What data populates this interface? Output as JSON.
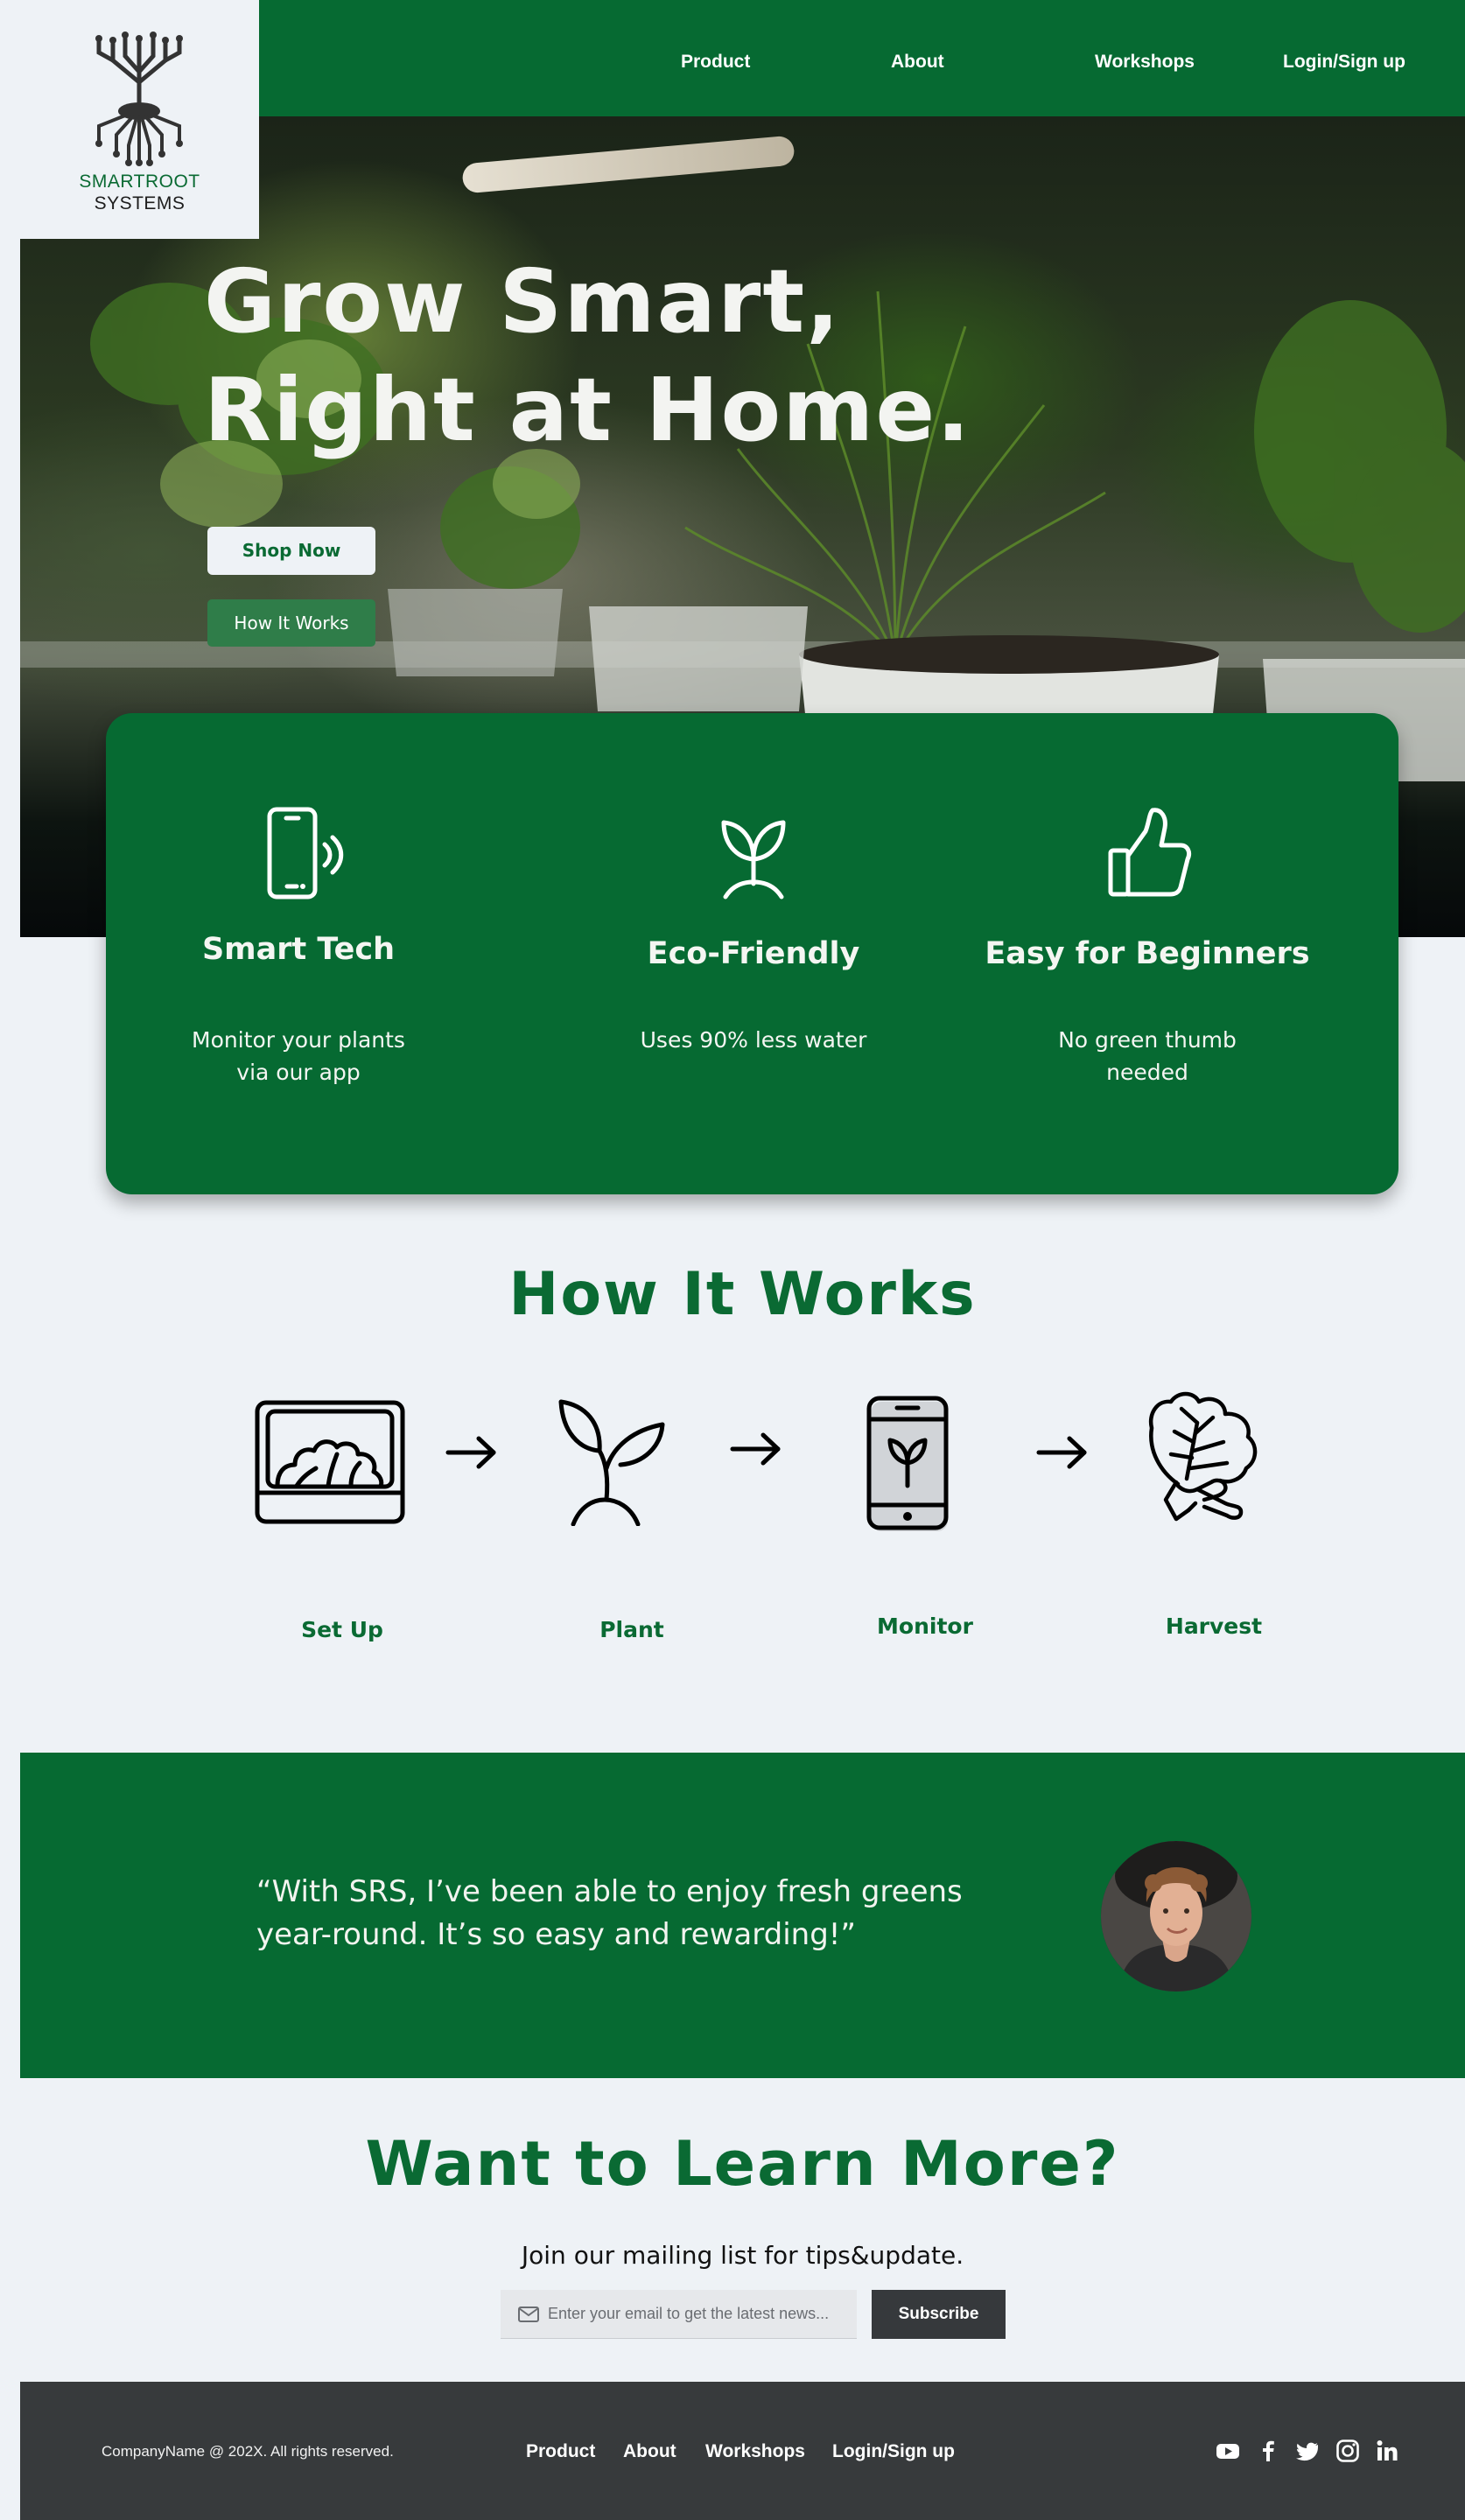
{
  "brand": {
    "line1": "SMARTROOT",
    "line2": "SYSTEMS",
    "logo_icon": "tree-roots-icon"
  },
  "nav": [
    "Product",
    "About",
    "Workshops",
    "Login/Sign up"
  ],
  "hero": {
    "title_line1": "Grow Smart,",
    "title_line2": "Right at Home.",
    "primary_button": "Shop Now",
    "secondary_button": "How It Works"
  },
  "features": [
    {
      "icon": "smartphone-wireless-icon",
      "title": "Smart Tech",
      "desc_line1": "Monitor your plants",
      "desc_line2": "via our app"
    },
    {
      "icon": "sprout-icon",
      "title": "Eco-Friendly",
      "desc_line1": "Uses 90% less water",
      "desc_line2": ""
    },
    {
      "icon": "thumbs-up-icon",
      "title": "Easy for Beginners",
      "desc_line1": "No green thumb needed",
      "desc_line2": ""
    }
  ],
  "how_it_works": {
    "title": "How It Works",
    "steps": [
      {
        "icon": "grow-box-icon",
        "label": "Set Up"
      },
      {
        "icon": "seedling-icon",
        "label": "Plant"
      },
      {
        "icon": "phone-plant-icon",
        "label": "Monitor"
      },
      {
        "icon": "hand-holding-greens-icon",
        "label": "Harvest"
      }
    ]
  },
  "testimonial": {
    "quote_line1": "“With SRS, I’ve been able to enjoy fresh greens",
    "quote_line2": "year-round. It’s so easy and rewarding!”"
  },
  "newsletter": {
    "title": "Want to Learn More?",
    "subtitle": "Join our mailing list for tips&update.",
    "placeholder": "Enter your email to get the latest news...",
    "button": "Subscribe"
  },
  "footer": {
    "copyright": "CompanyName @ 202X. All rights reserved.",
    "links": [
      "Product",
      "About",
      "Workshops",
      "Login/Sign up"
    ],
    "social": [
      "youtube-icon",
      "facebook-icon",
      "twitter-icon",
      "instagram-icon",
      "linkedin-icon"
    ]
  },
  "colors": {
    "primary_green": "#066a32",
    "background": "#eef2f6",
    "footer": "#373a3c",
    "button_dark": "#36393c"
  }
}
